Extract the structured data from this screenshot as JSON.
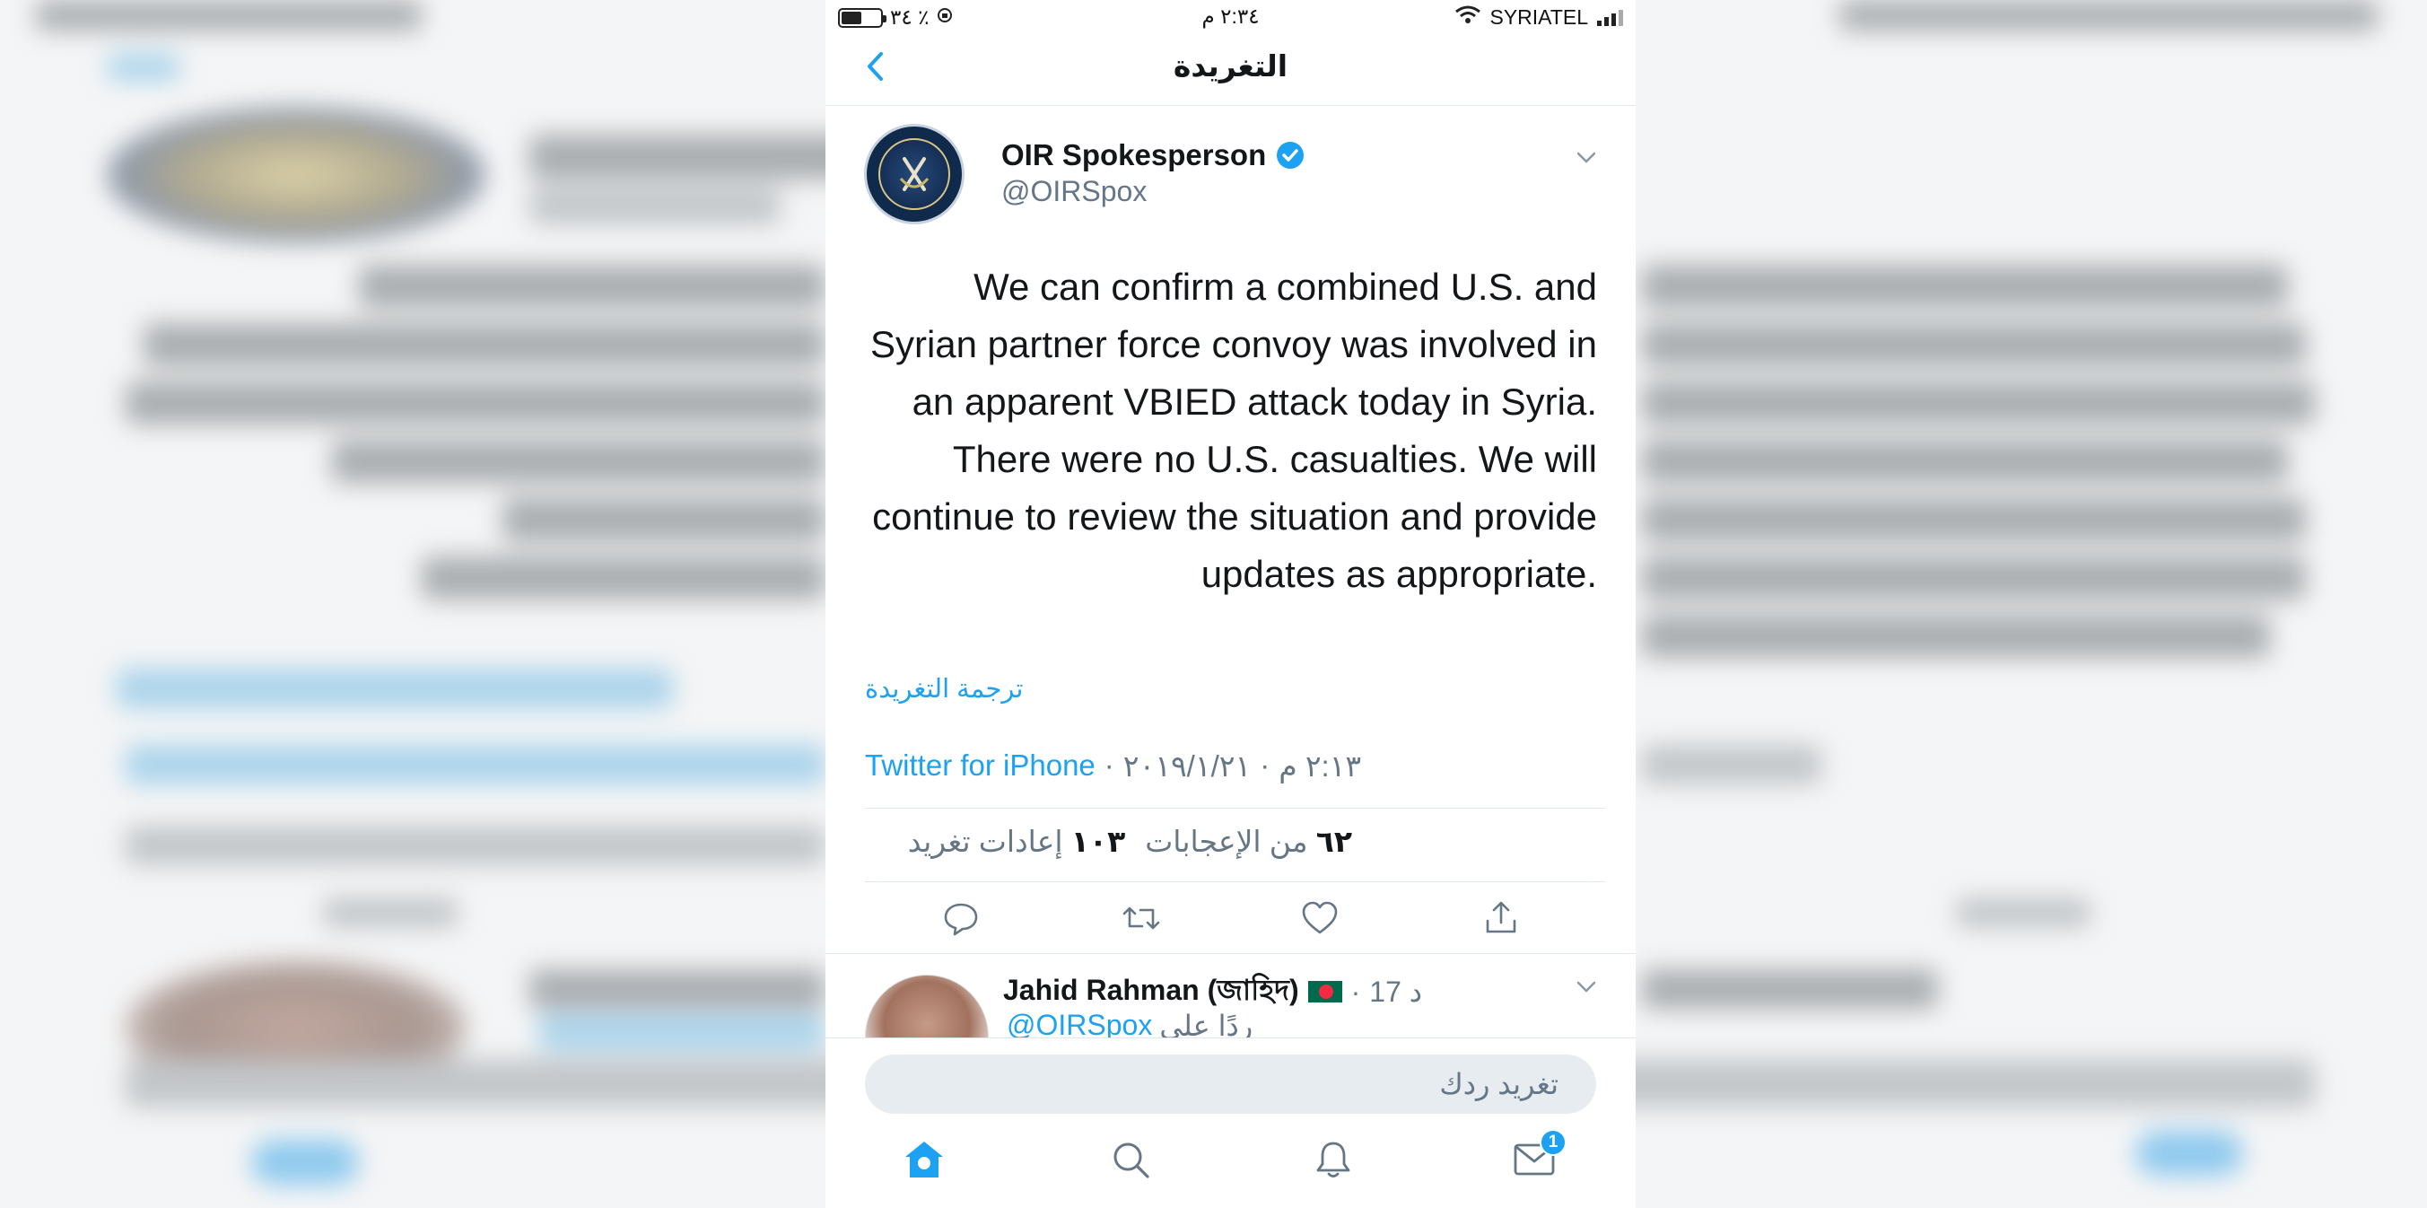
{
  "status_bar": {
    "battery": "٣٤ ٪",
    "time": "٢:٣٤ م",
    "carrier": "SYRIATEL"
  },
  "header": {
    "title": "التغريدة",
    "back_icon": "chevron-left-icon"
  },
  "tweet": {
    "author_name": "OIR Spokesperson",
    "author_handle": "@OIRSpox",
    "verified": true,
    "text": "We can confirm a combined U.S. and Syrian partner force convoy was involved in an apparent VBIED attack today in Syria. There were no U.S. casualties.  We will continue to review the situation and provide updates as appropriate.",
    "translate_label": "ترجمة التغريدة",
    "time": "٢:١٣ م",
    "date": "٢٠١٩/١/٢١",
    "separator": "·",
    "source": "Twitter for iPhone",
    "retweets_count": "١٠٣",
    "retweets_label": "إعادات تغريد",
    "likes_count": "٦٢",
    "likes_label": "من الإعجابات"
  },
  "reply": {
    "author_name": "Jahid Rahman (জাহিদ)",
    "time": "17 د",
    "separator": "·",
    "replying_to_label": "ردًا على",
    "replying_to_handle": "@OIRSpox"
  },
  "compose": {
    "placeholder": "تغريد ردك"
  },
  "tab_bar": {
    "messages_badge": "1"
  },
  "colors": {
    "accent": "#1da1f2",
    "text_primary": "#14171a",
    "text_secondary": "#657786",
    "divider": "#e1e8ed"
  }
}
